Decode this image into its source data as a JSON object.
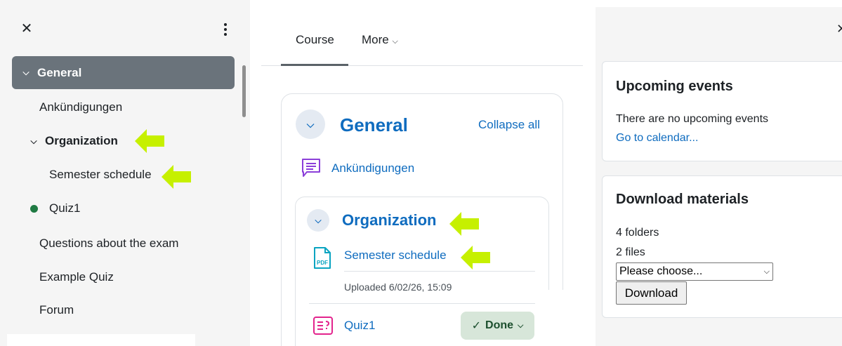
{
  "left_drawer": {
    "close_glyph": "✕",
    "items": [
      {
        "label": "General",
        "state": "expanded",
        "active": true
      },
      {
        "label": "Ankündigungen"
      },
      {
        "label": "Organization",
        "state": "expanded"
      },
      {
        "label": "Semester schedule"
      },
      {
        "label": "Quiz1",
        "completed": true
      },
      {
        "label": "Questions about the exam"
      },
      {
        "label": "Example Quiz"
      },
      {
        "label": "Forum"
      }
    ]
  },
  "tabs": [
    {
      "label": "Course",
      "active": true
    },
    {
      "label": "More"
    }
  ],
  "course": {
    "section_general": "General",
    "collapse_all": "Collapse all",
    "ankuendigungen": "Ankündigungen",
    "section_organization": "Organization",
    "semester_schedule": "Semester schedule",
    "uploaded": "Uploaded 6/02/26, 15:09",
    "pdf_label": "PDF",
    "quiz1": "Quiz1",
    "done_label": "Done"
  },
  "right_drawer": {
    "upcoming": {
      "title": "Upcoming events",
      "text": "There are no upcoming events",
      "link": "Go to calendar..."
    },
    "download": {
      "title": "Download materials",
      "folders": "4 folders",
      "files": "2 files",
      "select_value": "Please choose...",
      "button": "Download"
    }
  },
  "colors": {
    "link_blue": "#0f6cbf",
    "active_item_bg": "#6a737b",
    "done_bg": "#d7e6d9",
    "arrow_green": "#c6f000",
    "completion_dot": "#1f7a43"
  },
  "icons": [
    "close-icon",
    "kebab-menu-icon",
    "chevron-down-icon",
    "forum-icon",
    "pdf-file-icon",
    "quiz-icon",
    "check-icon",
    "annotation-arrow-icon"
  ]
}
